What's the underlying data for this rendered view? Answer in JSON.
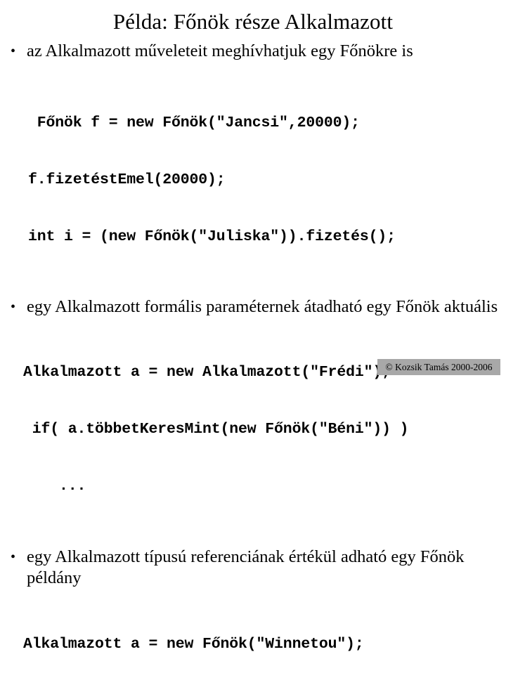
{
  "slide": {
    "title": "Példa: Főnök része Alkalmazott",
    "bullet_marker": "•",
    "bullets": [
      {
        "id": "bullet-1",
        "text": "az Alkalmazott műveleteit meghívhatjuk egy Főnökre is"
      },
      {
        "id": "bullet-2",
        "text": "egy Alkalmazott formális paraméternek átadható egy Főnök aktuális"
      },
      {
        "id": "bullet-3",
        "text": "egy Alkalmazott típusú referenciának értékül adható egy Főnök példány"
      }
    ],
    "code_blocks": [
      {
        "id": "code-block-1",
        "lines": [
          " Főnök f = new Főnök(\"Jancsi\",20000);",
          "f.fizetéstEmel(20000);",
          "int i = (new Főnök(\"Juliska\")).fizetés();"
        ]
      },
      {
        "id": "code-block-2",
        "lines": [
          "Alkalmazott a = new Alkalmazott(\"Frédi\");",
          " if( a.többetKeresMint(new Főnök(\"Béni\")) )",
          "    ..."
        ]
      },
      {
        "id": "code-block-3",
        "lines": [
          "Alkalmazott a = new Főnök(\"Winnetou\");"
        ]
      }
    ],
    "footer": {
      "text": "© Kozsik Tamás 2000-2006",
      "background_color": "#a8a8a8"
    },
    "colors": {
      "page_background": "#ffffff",
      "text": "#000000"
    }
  }
}
